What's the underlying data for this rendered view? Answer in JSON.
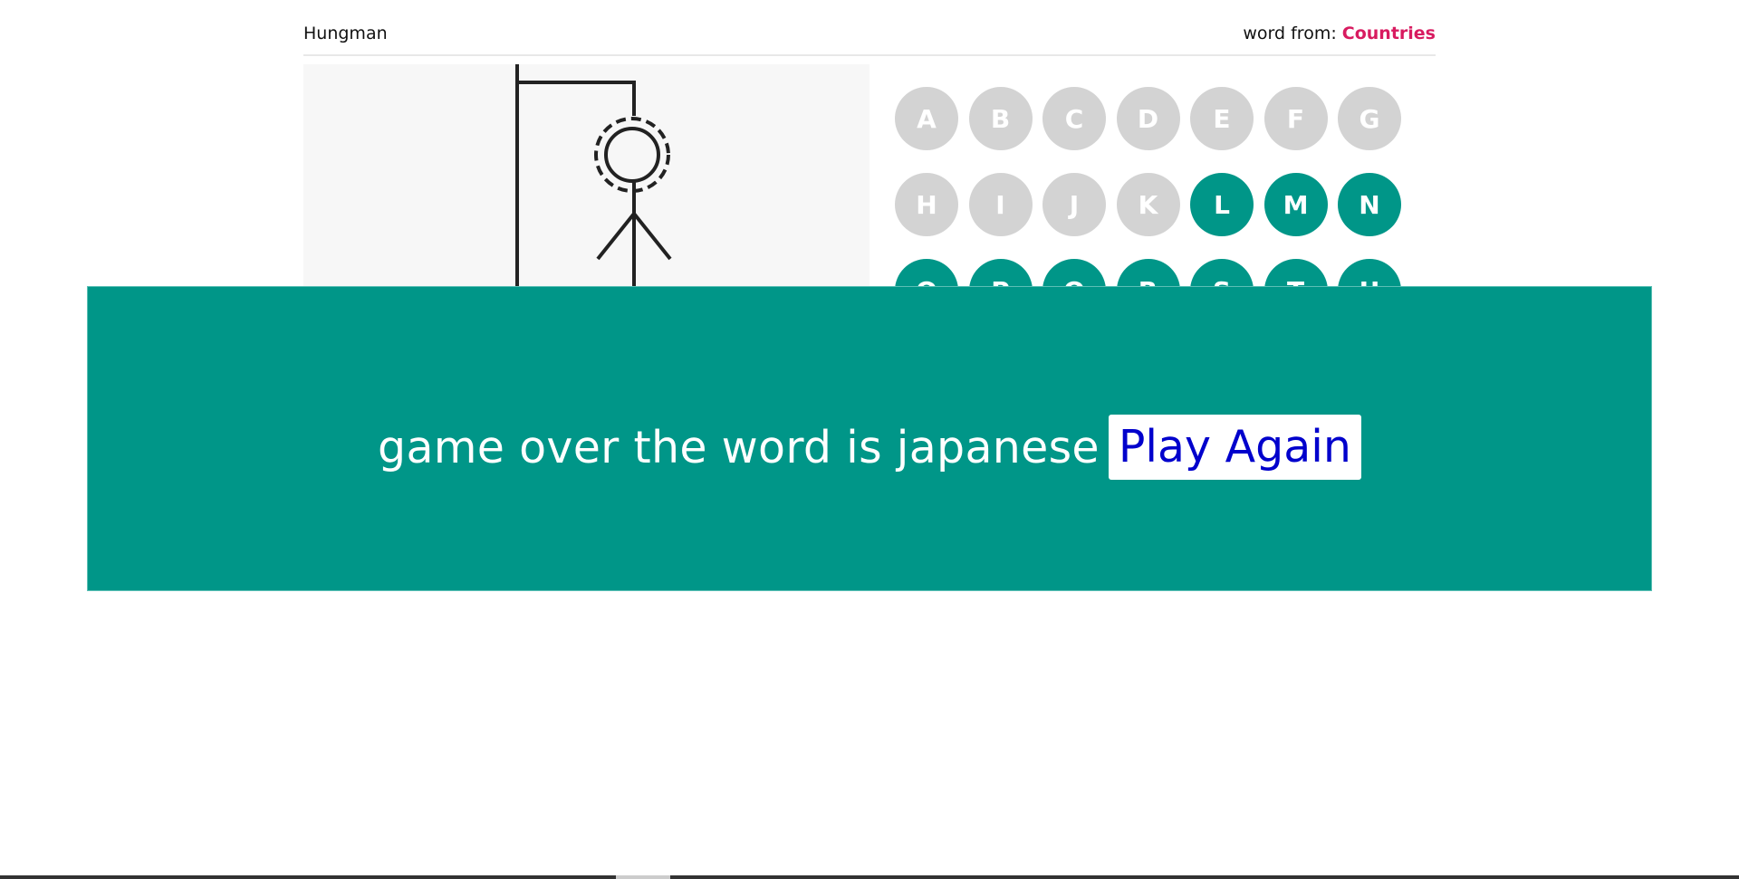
{
  "header": {
    "app_title": "Hungman",
    "category_label": "word from:",
    "category_name": "Countries"
  },
  "keyboard": {
    "keys": [
      {
        "letter": "A",
        "state": "used"
      },
      {
        "letter": "B",
        "state": "used"
      },
      {
        "letter": "C",
        "state": "used"
      },
      {
        "letter": "D",
        "state": "used"
      },
      {
        "letter": "E",
        "state": "used"
      },
      {
        "letter": "F",
        "state": "used"
      },
      {
        "letter": "G",
        "state": "used"
      },
      {
        "letter": "H",
        "state": "used"
      },
      {
        "letter": "I",
        "state": "used"
      },
      {
        "letter": "J",
        "state": "used"
      },
      {
        "letter": "K",
        "state": "used"
      },
      {
        "letter": "L",
        "state": "active"
      },
      {
        "letter": "M",
        "state": "active"
      },
      {
        "letter": "N",
        "state": "active"
      },
      {
        "letter": "O",
        "state": "active"
      },
      {
        "letter": "P",
        "state": "active"
      },
      {
        "letter": "Q",
        "state": "active"
      },
      {
        "letter": "R",
        "state": "active"
      },
      {
        "letter": "S",
        "state": "active"
      },
      {
        "letter": "T",
        "state": "active"
      },
      {
        "letter": "U",
        "state": "active"
      }
    ]
  },
  "game_over": {
    "message": "game over the word is japanese",
    "play_again_label": "Play Again"
  },
  "colors": {
    "accent": "#009688",
    "category": "#d81b60",
    "used_key": "#d3d3d3",
    "button_text": "#0000cc"
  }
}
